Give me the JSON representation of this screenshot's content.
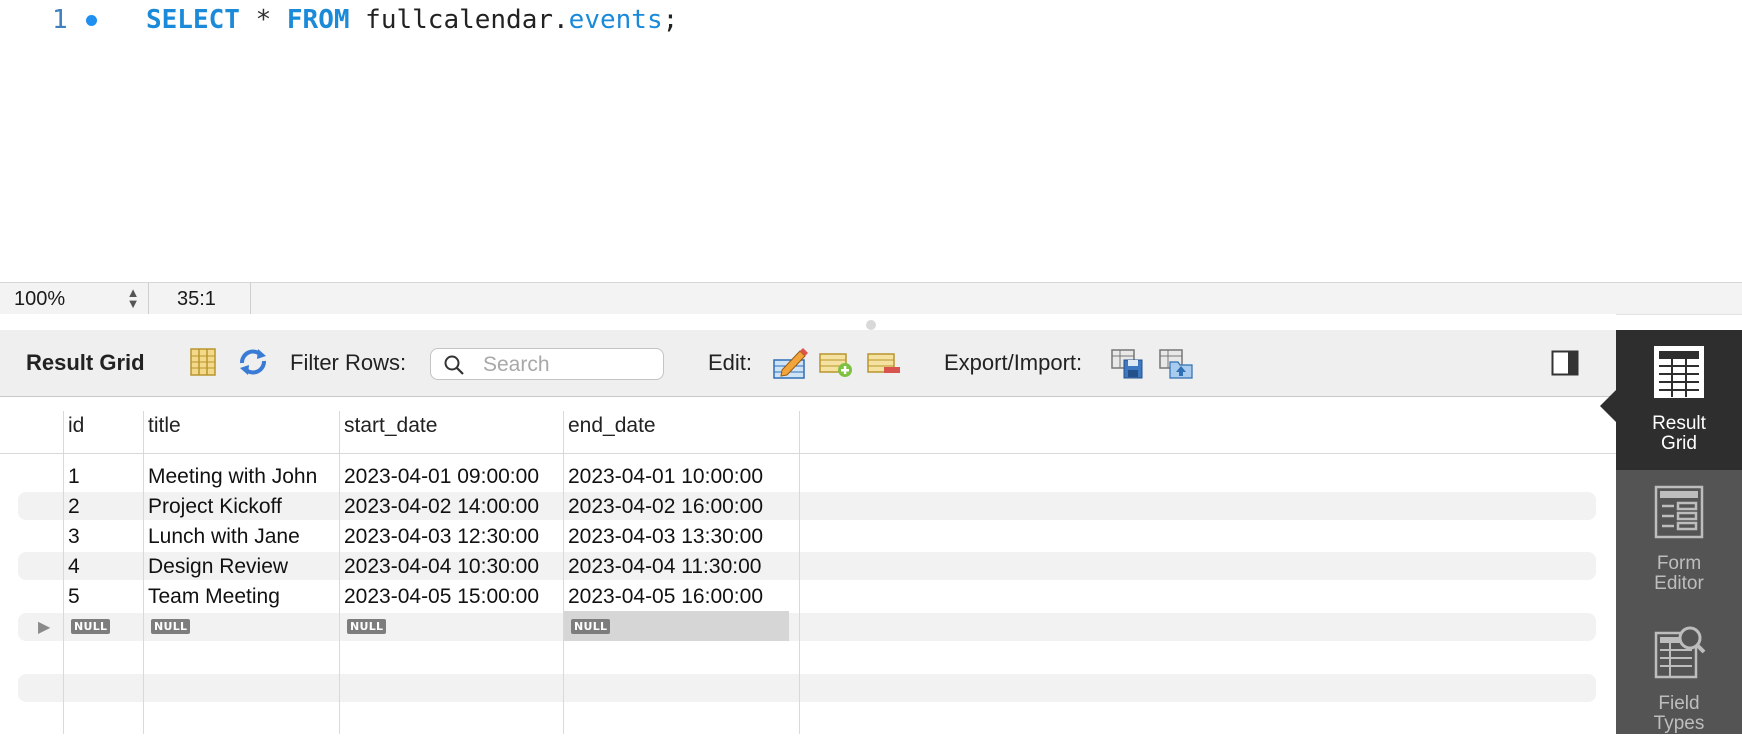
{
  "editor": {
    "line_number": "1",
    "tokens": {
      "kw1": "SELECT",
      "op": "*",
      "kw2": "FROM",
      "schema": "fullcalendar",
      "dot": ".",
      "table": "events",
      "semicolon": ";"
    }
  },
  "statusbar": {
    "zoom": "100%",
    "cursor_position": "35:1"
  },
  "toolbar": {
    "title": "Result Grid",
    "filter_label": "Filter Rows:",
    "search_placeholder": "Search",
    "edit_label": "Edit:",
    "export_label": "Export/Import:"
  },
  "grid": {
    "columns": [
      "id",
      "title",
      "start_date",
      "end_date"
    ],
    "rows": [
      [
        "1",
        "Meeting with John",
        "2023-04-01 09:00:00",
        "2023-04-01 10:00:00"
      ],
      [
        "2",
        "Project Kickoff",
        "2023-04-02 14:00:00",
        "2023-04-02 16:00:00"
      ],
      [
        "3",
        "Lunch with Jane",
        "2023-04-03 12:30:00",
        "2023-04-03 13:30:00"
      ],
      [
        "4",
        "Design Review",
        "2023-04-04 10:30:00",
        "2023-04-04 11:30:00"
      ],
      [
        "5",
        "Team Meeting",
        "2023-04-05 15:00:00",
        "2023-04-05 16:00:00"
      ]
    ],
    "new_row_marker": "▶",
    "null_label": "NULL"
  },
  "side_panel": {
    "items": [
      {
        "label_line1": "Result",
        "label_line2": "Grid"
      },
      {
        "label_line1": "Form",
        "label_line2": "Editor"
      },
      {
        "label_line1": "Field",
        "label_line2": "Types"
      }
    ]
  },
  "colors": {
    "keyword": "#1a8ad9",
    "side_active": "#2e2e2e",
    "side_bg": "#545454",
    "null_badge": "#7d7d7d"
  }
}
